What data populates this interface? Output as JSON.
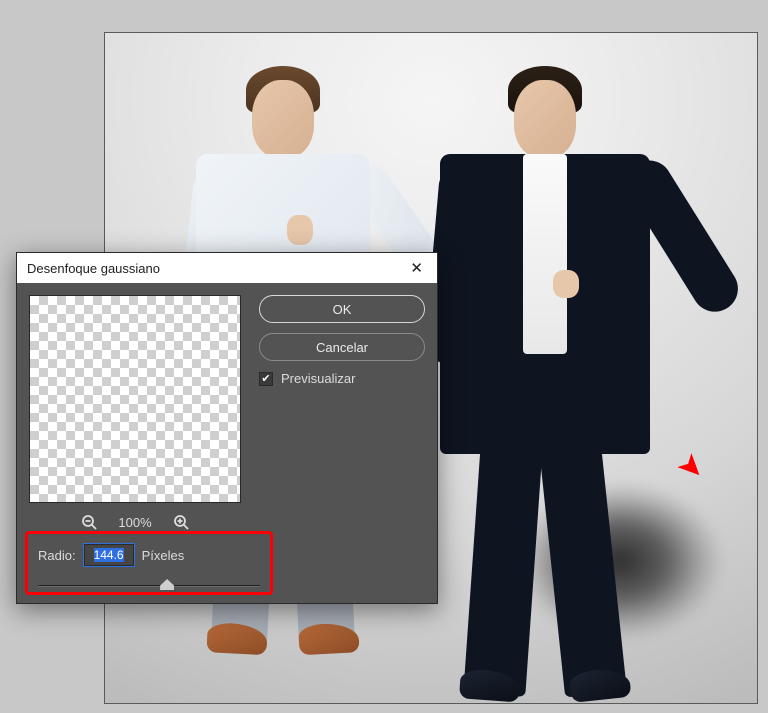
{
  "dialog": {
    "title": "Desenfoque gaussiano",
    "ok_label": "OK",
    "cancel_label": "Cancelar",
    "preview_label": "Previsualizar",
    "preview_checked": true,
    "zoom_level": "100%",
    "radius_label": "Radio:",
    "radius_value": "144.6",
    "radius_units": "Píxeles"
  }
}
